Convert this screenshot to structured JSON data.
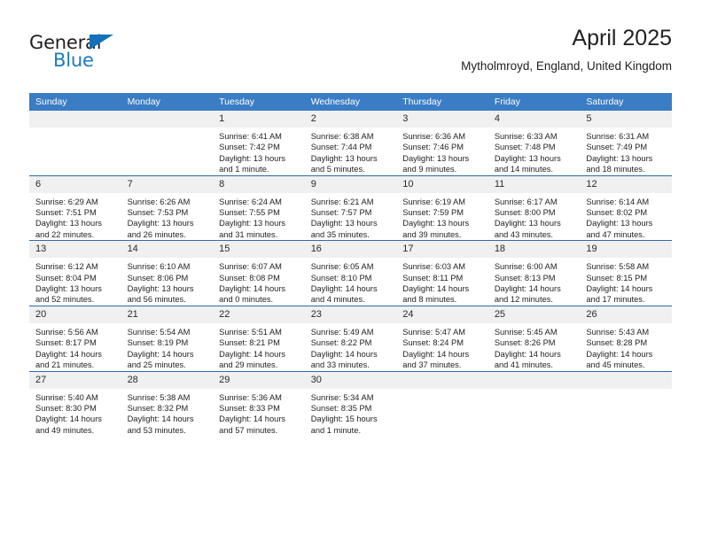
{
  "logo": {
    "name_part1": "General",
    "name_part2": "Blue",
    "triangle_color": "#1271b8",
    "blue_color": "#1b7ac4"
  },
  "header": {
    "title": "April 2025",
    "subtitle": "Mytholmroyd, England, United Kingdom"
  },
  "colors": {
    "header_bar": "#3b7dc4",
    "row_divider": "#2f6aa8",
    "date_band": "#f0f0f0"
  },
  "weekdays": [
    "Sunday",
    "Monday",
    "Tuesday",
    "Wednesday",
    "Thursday",
    "Friday",
    "Saturday"
  ],
  "weeks": [
    [
      {
        "day": "",
        "sunrise": "",
        "sunset": "",
        "daylight_line1": "",
        "daylight_line2": "",
        "empty": true
      },
      {
        "day": "",
        "sunrise": "",
        "sunset": "",
        "daylight_line1": "",
        "daylight_line2": "",
        "empty": true
      },
      {
        "day": "1",
        "sunrise": "Sunrise: 6:41 AM",
        "sunset": "Sunset: 7:42 PM",
        "daylight_line1": "Daylight: 13 hours",
        "daylight_line2": "and 1 minute."
      },
      {
        "day": "2",
        "sunrise": "Sunrise: 6:38 AM",
        "sunset": "Sunset: 7:44 PM",
        "daylight_line1": "Daylight: 13 hours",
        "daylight_line2": "and 5 minutes."
      },
      {
        "day": "3",
        "sunrise": "Sunrise: 6:36 AM",
        "sunset": "Sunset: 7:46 PM",
        "daylight_line1": "Daylight: 13 hours",
        "daylight_line2": "and 9 minutes."
      },
      {
        "day": "4",
        "sunrise": "Sunrise: 6:33 AM",
        "sunset": "Sunset: 7:48 PM",
        "daylight_line1": "Daylight: 13 hours",
        "daylight_line2": "and 14 minutes."
      },
      {
        "day": "5",
        "sunrise": "Sunrise: 6:31 AM",
        "sunset": "Sunset: 7:49 PM",
        "daylight_line1": "Daylight: 13 hours",
        "daylight_line2": "and 18 minutes."
      }
    ],
    [
      {
        "day": "6",
        "sunrise": "Sunrise: 6:29 AM",
        "sunset": "Sunset: 7:51 PM",
        "daylight_line1": "Daylight: 13 hours",
        "daylight_line2": "and 22 minutes."
      },
      {
        "day": "7",
        "sunrise": "Sunrise: 6:26 AM",
        "sunset": "Sunset: 7:53 PM",
        "daylight_line1": "Daylight: 13 hours",
        "daylight_line2": "and 26 minutes."
      },
      {
        "day": "8",
        "sunrise": "Sunrise: 6:24 AM",
        "sunset": "Sunset: 7:55 PM",
        "daylight_line1": "Daylight: 13 hours",
        "daylight_line2": "and 31 minutes."
      },
      {
        "day": "9",
        "sunrise": "Sunrise: 6:21 AM",
        "sunset": "Sunset: 7:57 PM",
        "daylight_line1": "Daylight: 13 hours",
        "daylight_line2": "and 35 minutes."
      },
      {
        "day": "10",
        "sunrise": "Sunrise: 6:19 AM",
        "sunset": "Sunset: 7:59 PM",
        "daylight_line1": "Daylight: 13 hours",
        "daylight_line2": "and 39 minutes."
      },
      {
        "day": "11",
        "sunrise": "Sunrise: 6:17 AM",
        "sunset": "Sunset: 8:00 PM",
        "daylight_line1": "Daylight: 13 hours",
        "daylight_line2": "and 43 minutes."
      },
      {
        "day": "12",
        "sunrise": "Sunrise: 6:14 AM",
        "sunset": "Sunset: 8:02 PM",
        "daylight_line1": "Daylight: 13 hours",
        "daylight_line2": "and 47 minutes."
      }
    ],
    [
      {
        "day": "13",
        "sunrise": "Sunrise: 6:12 AM",
        "sunset": "Sunset: 8:04 PM",
        "daylight_line1": "Daylight: 13 hours",
        "daylight_line2": "and 52 minutes."
      },
      {
        "day": "14",
        "sunrise": "Sunrise: 6:10 AM",
        "sunset": "Sunset: 8:06 PM",
        "daylight_line1": "Daylight: 13 hours",
        "daylight_line2": "and 56 minutes."
      },
      {
        "day": "15",
        "sunrise": "Sunrise: 6:07 AM",
        "sunset": "Sunset: 8:08 PM",
        "daylight_line1": "Daylight: 14 hours",
        "daylight_line2": "and 0 minutes."
      },
      {
        "day": "16",
        "sunrise": "Sunrise: 6:05 AM",
        "sunset": "Sunset: 8:10 PM",
        "daylight_line1": "Daylight: 14 hours",
        "daylight_line2": "and 4 minutes."
      },
      {
        "day": "17",
        "sunrise": "Sunrise: 6:03 AM",
        "sunset": "Sunset: 8:11 PM",
        "daylight_line1": "Daylight: 14 hours",
        "daylight_line2": "and 8 minutes."
      },
      {
        "day": "18",
        "sunrise": "Sunrise: 6:00 AM",
        "sunset": "Sunset: 8:13 PM",
        "daylight_line1": "Daylight: 14 hours",
        "daylight_line2": "and 12 minutes."
      },
      {
        "day": "19",
        "sunrise": "Sunrise: 5:58 AM",
        "sunset": "Sunset: 8:15 PM",
        "daylight_line1": "Daylight: 14 hours",
        "daylight_line2": "and 17 minutes."
      }
    ],
    [
      {
        "day": "20",
        "sunrise": "Sunrise: 5:56 AM",
        "sunset": "Sunset: 8:17 PM",
        "daylight_line1": "Daylight: 14 hours",
        "daylight_line2": "and 21 minutes."
      },
      {
        "day": "21",
        "sunrise": "Sunrise: 5:54 AM",
        "sunset": "Sunset: 8:19 PM",
        "daylight_line1": "Daylight: 14 hours",
        "daylight_line2": "and 25 minutes."
      },
      {
        "day": "22",
        "sunrise": "Sunrise: 5:51 AM",
        "sunset": "Sunset: 8:21 PM",
        "daylight_line1": "Daylight: 14 hours",
        "daylight_line2": "and 29 minutes."
      },
      {
        "day": "23",
        "sunrise": "Sunrise: 5:49 AM",
        "sunset": "Sunset: 8:22 PM",
        "daylight_line1": "Daylight: 14 hours",
        "daylight_line2": "and 33 minutes."
      },
      {
        "day": "24",
        "sunrise": "Sunrise: 5:47 AM",
        "sunset": "Sunset: 8:24 PM",
        "daylight_line1": "Daylight: 14 hours",
        "daylight_line2": "and 37 minutes."
      },
      {
        "day": "25",
        "sunrise": "Sunrise: 5:45 AM",
        "sunset": "Sunset: 8:26 PM",
        "daylight_line1": "Daylight: 14 hours",
        "daylight_line2": "and 41 minutes."
      },
      {
        "day": "26",
        "sunrise": "Sunrise: 5:43 AM",
        "sunset": "Sunset: 8:28 PM",
        "daylight_line1": "Daylight: 14 hours",
        "daylight_line2": "and 45 minutes."
      }
    ],
    [
      {
        "day": "27",
        "sunrise": "Sunrise: 5:40 AM",
        "sunset": "Sunset: 8:30 PM",
        "daylight_line1": "Daylight: 14 hours",
        "daylight_line2": "and 49 minutes."
      },
      {
        "day": "28",
        "sunrise": "Sunrise: 5:38 AM",
        "sunset": "Sunset: 8:32 PM",
        "daylight_line1": "Daylight: 14 hours",
        "daylight_line2": "and 53 minutes."
      },
      {
        "day": "29",
        "sunrise": "Sunrise: 5:36 AM",
        "sunset": "Sunset: 8:33 PM",
        "daylight_line1": "Daylight: 14 hours",
        "daylight_line2": "and 57 minutes."
      },
      {
        "day": "30",
        "sunrise": "Sunrise: 5:34 AM",
        "sunset": "Sunset: 8:35 PM",
        "daylight_line1": "Daylight: 15 hours",
        "daylight_line2": "and 1 minute."
      },
      {
        "day": "",
        "sunrise": "",
        "sunset": "",
        "daylight_line1": "",
        "daylight_line2": "",
        "empty": true
      },
      {
        "day": "",
        "sunrise": "",
        "sunset": "",
        "daylight_line1": "",
        "daylight_line2": "",
        "empty": true
      },
      {
        "day": "",
        "sunrise": "",
        "sunset": "",
        "daylight_line1": "",
        "daylight_line2": "",
        "empty": true
      }
    ]
  ]
}
